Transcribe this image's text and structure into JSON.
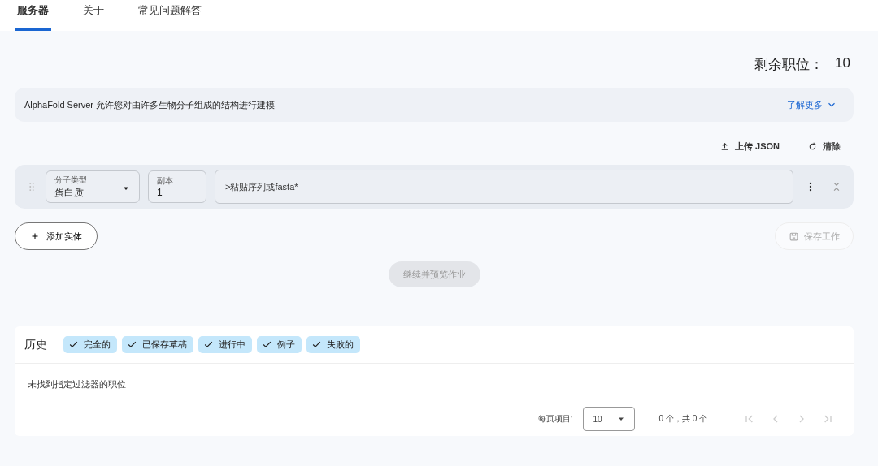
{
  "tabs": [
    {
      "label": "服务器",
      "selected": true
    },
    {
      "label": "关于",
      "selected": false
    },
    {
      "label": "常见问题解答",
      "selected": false
    }
  ],
  "quota": {
    "label": "剩余职位：",
    "value": "10"
  },
  "banner": {
    "text": "AlphaFold Server 允许您对由许多生物分子组成的结构进行建模",
    "link": "了解更多"
  },
  "actions": [
    {
      "kind": "upload",
      "label": "上传 JSON"
    },
    {
      "kind": "clear",
      "label": "清除"
    }
  ],
  "entities": [
    {
      "type_label": "分子类型",
      "type_value": "蛋白质",
      "copies_label": "副本",
      "copies_value": "1",
      "sequence_placeholder": ">粘贴序列或fasta*"
    }
  ],
  "add_button": "添加实体",
  "save_button": {
    "label": "保存工作",
    "disabled": true
  },
  "continue_button": {
    "label": "继续并预览作业",
    "disabled": true
  },
  "history": {
    "title": "历史",
    "filters": [
      {
        "label": "完全的",
        "checked": true
      },
      {
        "label": "已保存草稿",
        "checked": true
      },
      {
        "label": "进行中",
        "checked": true
      },
      {
        "label": "例子",
        "checked": true
      },
      {
        "label": "失败的",
        "checked": true
      }
    ],
    "empty_message": "未找到指定过滤器的职位",
    "pagination": {
      "label": "每页项目:",
      "page_size": "10",
      "range": "0 个，共 0 个"
    }
  }
}
